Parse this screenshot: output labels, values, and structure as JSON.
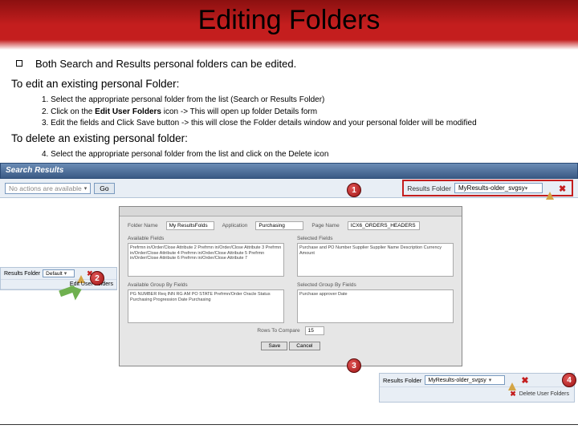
{
  "title": "Editing Folders",
  "bullet": "Both Search and Results personal folders can be edited.",
  "section_edit": "To edit an existing personal Folder:",
  "steps_edit": [
    "1. Select the appropriate personal folder from the list (Search or Results Folder)",
    "2. Click on the ",
    "Edit  User Folders",
    " icon -> This will open up folder Details form",
    "3. Edit the fields and Click Save button -> this will close the Folder details window and your personal folder will be modified"
  ],
  "section_delete": "To delete an existing personal folder:",
  "steps_delete": "4. Select the appropriate personal folder from the list and click on the Delete icon",
  "search_bar": {
    "label": "Search Results"
  },
  "action_row": {
    "no_actions": "No actions are available",
    "go": "Go",
    "results_folder_label": "Results Folder",
    "results_folder_value": "MyResults-older_svgsy"
  },
  "callouts": {
    "c1": "1",
    "c2": "2",
    "c3": "3",
    "c4": "4"
  },
  "dialog": {
    "folder_name_label": "Folder Name",
    "folder_name_value": "My ResultsFolds",
    "application_label": "Application",
    "application_value": "Purchasing",
    "page_name_label": "Page Name",
    "page_name_value": "ICX6_ORDERS_HEADERS",
    "available_head": "Available Fields",
    "selected_head": "Selected Fields",
    "available_items": "Prefrmn in/Order/Close Attribute 2\nPrefrmn in/Order/Close Attribute 3\nPrefrmn in/Order/Close Attribute 4\nPrefrmn in/Order/Close Attribute 5\nPrefrmn in/Order/Close Attribute 6\nPrefrmn in/Order/Close Attribute 7",
    "selected_items": "Purchase and PO Number\nSupplier\nSupplier Name\nDescription\nCurrency\nAmount",
    "group_avail": "Available Group By Fields",
    "group_sel": "Selected Group By Fields",
    "group_items": "PG NUMBER\nReq INN RG AM\nPO STATE\nPrefrmn/Order Oracle Status\nPurchasing Progression Date\nPurchasing",
    "sel_group_item": "Purchase approver Date",
    "rows_label": "Rows To Compare",
    "rows_value": "15",
    "save_btn": "Save",
    "cancel_btn": "Cancel"
  },
  "left_panel": {
    "label": "Results Folder",
    "value": "Default",
    "sub": "Edit User Folders"
  },
  "br_panel": {
    "label": "Results Folder",
    "value": "MyResults-older_svgsy",
    "sub": "Delete User Folders"
  }
}
